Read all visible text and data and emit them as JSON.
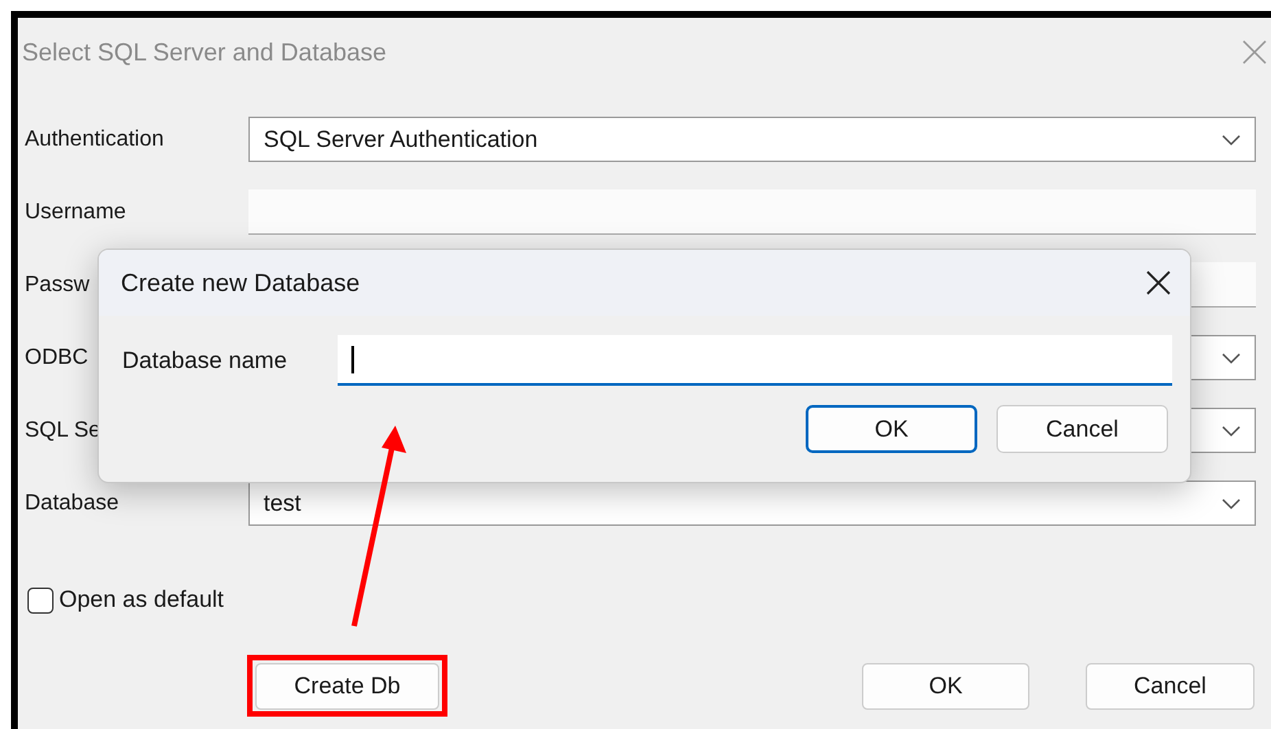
{
  "window": {
    "title": "Select SQL Server and Database"
  },
  "fields": [
    {
      "kind": "combo",
      "label": "Authentication",
      "value": "SQL Server Authentication"
    },
    {
      "kind": "text",
      "label": "Username"
    },
    {
      "kind": "text",
      "label": "Passw"
    },
    {
      "kind": "combo",
      "label": "ODBC"
    },
    {
      "kind": "combo",
      "label": "SQL Se"
    },
    {
      "kind": "combo",
      "label": "Database",
      "value": "test"
    }
  ],
  "open_as_default": {
    "label": "Open as default",
    "checked": false
  },
  "buttons": [
    {
      "label": "Create Db"
    },
    {
      "label": "OK"
    },
    {
      "label": "Cancel"
    }
  ],
  "modal": {
    "title": "Create new Database",
    "field_label": "Database name",
    "buttons": [
      {
        "label": "OK",
        "default": true
      },
      {
        "label": "Cancel",
        "default": false
      }
    ]
  }
}
